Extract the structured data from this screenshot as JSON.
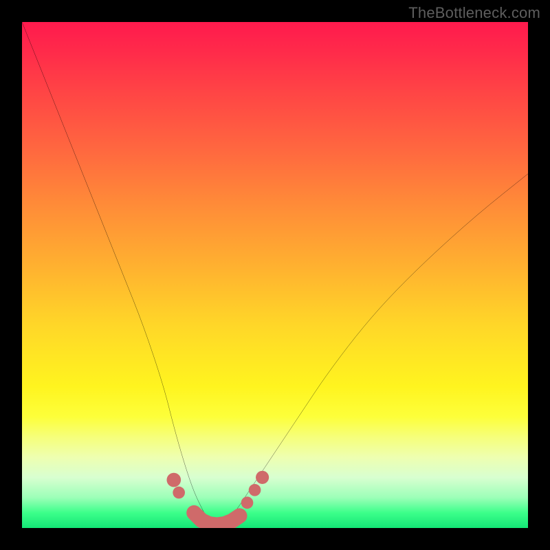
{
  "watermark": "TheBottleneck.com",
  "chart_data": {
    "type": "line",
    "title": "",
    "xlabel": "",
    "ylabel": "",
    "xlim": [
      0,
      100
    ],
    "ylim": [
      0,
      100
    ],
    "grid": false,
    "legend": false,
    "series": [
      {
        "name": "curve",
        "x": [
          0,
          4,
          8,
          12,
          16,
          20,
          24,
          28,
          30,
          32,
          34,
          36,
          37,
          38,
          39,
          40,
          42,
          44,
          48,
          52,
          56,
          60,
          66,
          72,
          80,
          90,
          100
        ],
        "y": [
          100,
          90,
          80,
          70,
          60,
          50,
          40,
          28,
          20,
          13,
          7,
          3,
          1,
          0,
          0,
          1,
          3,
          6,
          12,
          18,
          24,
          30,
          38,
          45,
          53,
          62,
          70
        ],
        "color": "#000000"
      }
    ],
    "markers": [
      {
        "name": "left-dot-upper",
        "x": 30.0,
        "y": 9.5,
        "r": 1.4,
        "color": "#cf6a6a"
      },
      {
        "name": "left-dot-lower",
        "x": 31.0,
        "y": 7.0,
        "r": 1.2,
        "color": "#cf6a6a"
      },
      {
        "name": "bottom-sausage",
        "path": [
          [
            34.0,
            3.0
          ],
          [
            35.5,
            1.5
          ],
          [
            37.0,
            0.8
          ],
          [
            38.5,
            0.6
          ],
          [
            40.0,
            0.8
          ],
          [
            41.5,
            1.4
          ],
          [
            43.0,
            2.4
          ]
        ],
        "width": 3.0,
        "color": "#cf6a6a"
      },
      {
        "name": "right-dot-lower",
        "x": 44.5,
        "y": 5.0,
        "r": 1.2,
        "color": "#cf6a6a"
      },
      {
        "name": "right-dot-mid",
        "x": 46.0,
        "y": 7.5,
        "r": 1.2,
        "color": "#cf6a6a"
      },
      {
        "name": "right-dot-upper",
        "x": 47.5,
        "y": 10.0,
        "r": 1.3,
        "color": "#cf6a6a"
      }
    ],
    "background_gradient": {
      "direction": "vertical",
      "stops": [
        {
          "pos": 0.0,
          "color": "#ff1a4d"
        },
        {
          "pos": 0.26,
          "color": "#ff6a3f"
        },
        {
          "pos": 0.48,
          "color": "#ffb030"
        },
        {
          "pos": 0.72,
          "color": "#fff41f"
        },
        {
          "pos": 0.9,
          "color": "#d8ffd0"
        },
        {
          "pos": 1.0,
          "color": "#14e676"
        }
      ]
    }
  }
}
